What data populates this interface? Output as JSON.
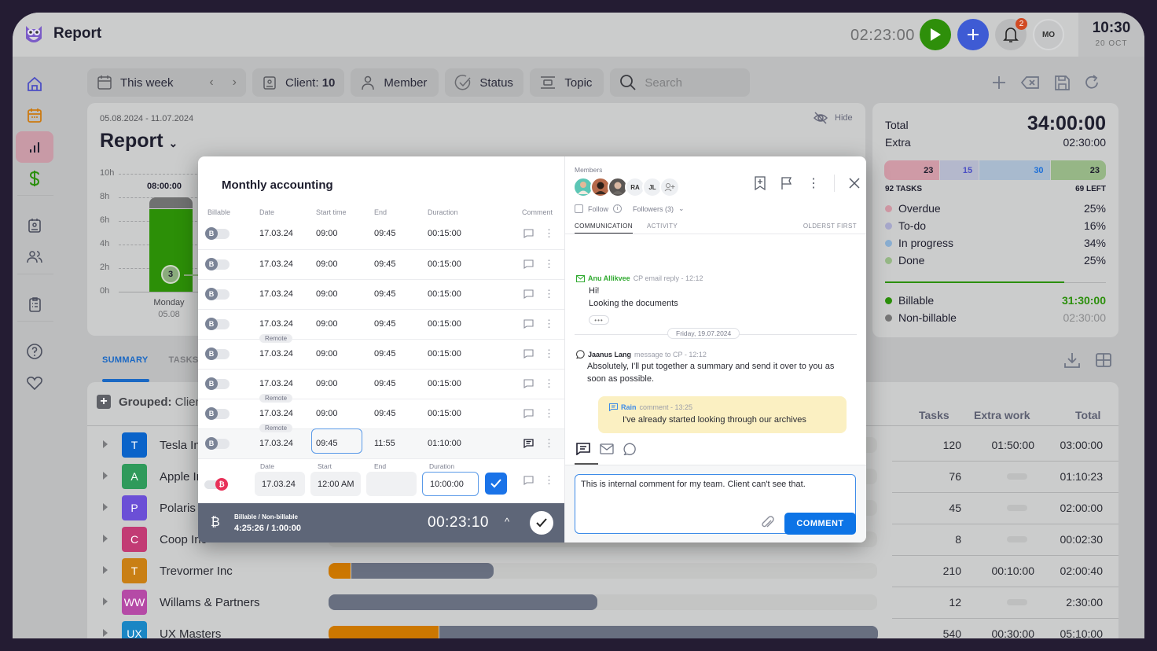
{
  "app": {
    "title": "Report"
  },
  "topbar": {
    "timer": "02:23:00",
    "notification_count": "2",
    "user_initials": "MO",
    "clock_time": "10:30",
    "clock_date": "20 OCT"
  },
  "sidebar": {
    "items": [
      {
        "name": "home",
        "icon": "home-icon"
      },
      {
        "name": "calendar",
        "icon": "calendar-icon"
      },
      {
        "name": "reports",
        "icon": "bar-chart-icon",
        "active": true
      },
      {
        "name": "billing",
        "icon": "dollar-icon"
      },
      {
        "name": "clients",
        "icon": "contact-card-icon"
      },
      {
        "name": "team",
        "icon": "users-icon"
      },
      {
        "name": "tasks",
        "icon": "clipboard-icon"
      },
      {
        "name": "help",
        "icon": "help-icon"
      },
      {
        "name": "favorites",
        "icon": "heart-icon"
      }
    ]
  },
  "filters": {
    "period": "This week",
    "client_label": "Client:",
    "client_count": "10",
    "member": "Member",
    "status": "Status",
    "topic": "Topic",
    "search_placeholder": "Search"
  },
  "report": {
    "date_range": "05.08.2024 - 11.07.2024",
    "title": "Report",
    "hide_label": "Hide"
  },
  "chart_data": {
    "type": "bar",
    "y_ticks": [
      "10h",
      "8h",
      "6h",
      "4h",
      "2h",
      "0h"
    ],
    "ylim": [
      0,
      10
    ],
    "categories": [
      {
        "day": "Monday",
        "date": "05.08"
      }
    ],
    "series": [
      {
        "name": "Billable",
        "values": [
          7
        ],
        "color": "#2c8f07"
      },
      {
        "name": "Non-billable",
        "values": [
          1
        ],
        "color": "#707171"
      }
    ],
    "total_labels": [
      "08:00:00"
    ],
    "bubble_label": "3"
  },
  "stats": {
    "total_label": "Total",
    "total_value": "34:00:00",
    "extra_label": "Extra",
    "extra_value": "02:30:00",
    "segments": [
      {
        "value": "23",
        "color": "#cf9aa6",
        "text": "#1e1e2e"
      },
      {
        "value": "15",
        "color": "#b4b8cc",
        "text": "#4b4fc4"
      },
      {
        "value": "30",
        "color": "#a8bace",
        "text": "#1e70d8"
      },
      {
        "value": "23",
        "color": "#96b686",
        "text": "#1e1e2e"
      }
    ],
    "tasks_count": "92 TASKS",
    "left_count": "69 LEFT",
    "legend": [
      {
        "label": "Overdue",
        "percent": "25%",
        "color": "#cf97a3"
      },
      {
        "label": "To-do",
        "percent": "16%",
        "color": "#a7a8cb"
      },
      {
        "label": "In progress",
        "percent": "34%",
        "color": "#8aaed1"
      },
      {
        "label": "Done",
        "percent": "25%",
        "color": "#96b886"
      }
    ],
    "billable_progress": 0.81,
    "billable_label": "Billable",
    "billable_value": "31:30:00",
    "nonbillable_label": "Non-billable",
    "nonbillable_value": "02:30:00"
  },
  "summary_tabs": [
    {
      "label": "SUMMARY",
      "active": true
    },
    {
      "label": "TASKS",
      "active": false
    }
  ],
  "table": {
    "grouped_label": "Grouped:",
    "grouped_value": "Client",
    "headers": {
      "tasks": "Tasks",
      "extra": "Extra work",
      "total": "Total"
    },
    "rows": [
      {
        "initial": "T",
        "name": "Tesla Inc",
        "color": "#0a63c9",
        "billable": 0,
        "nonbillable": 0,
        "tasks": "120",
        "extra": "01:50:00",
        "total": "03:00:00"
      },
      {
        "initial": "A",
        "name": "Apple Inc",
        "color": "#2f9a5b",
        "billable": 0,
        "nonbillable": 0,
        "tasks": "76",
        "extra": "",
        "total": "01:10:23"
      },
      {
        "initial": "P",
        "name": "Polaris Inc",
        "color": "#6b4fd6",
        "billable": 0,
        "nonbillable": 0,
        "tasks": "45",
        "extra": "",
        "total": "02:00:00"
      },
      {
        "initial": "C",
        "name": "Coop Inc",
        "color": "#c23b74",
        "billable": 0,
        "nonbillable": 0,
        "tasks": "8",
        "extra": "",
        "total": "00:02:30"
      },
      {
        "initial": "T",
        "name": "Trevormer Inc",
        "color": "#c97f14",
        "billable": 0.04,
        "nonbillable": 0.26,
        "tasks": "210",
        "extra": "00:10:00",
        "total": "02:00:40"
      },
      {
        "initial": "WW",
        "name": "Willams & Partners",
        "color": "#b54aa6",
        "billable": 0,
        "nonbillable": 0.49,
        "tasks": "12",
        "extra": "",
        "total": "2:30:00"
      },
      {
        "initial": "UX",
        "name": "UX Masters",
        "color": "#1a86c4",
        "billable": 0.2,
        "nonbillable": 0.8,
        "tasks": "540",
        "extra": "00:30:00",
        "total": "05:10:00"
      }
    ]
  },
  "modal": {
    "title": "Monthly accounting",
    "columns": [
      "Billable",
      "Date",
      "Start time",
      "End",
      "Duraction",
      "Comment"
    ],
    "entries": [
      {
        "date": "17.03.24",
        "start": "09:00",
        "end": "09:45",
        "duration": "00:15:00",
        "tag": ""
      },
      {
        "date": "17.03.24",
        "start": "09:00",
        "end": "09:45",
        "duration": "00:15:00",
        "tag": ""
      },
      {
        "date": "17.03.24",
        "start": "09:00",
        "end": "09:45",
        "duration": "00:15:00",
        "tag": ""
      },
      {
        "date": "17.03.24",
        "start": "09:00",
        "end": "09:45",
        "duration": "00:15:00",
        "tag": ""
      },
      {
        "date": "17.03.24",
        "start": "09:00",
        "end": "09:45",
        "duration": "00:15:00",
        "tag": "Remote"
      },
      {
        "date": "17.03.24",
        "start": "09:00",
        "end": "09:45",
        "duration": "00:15:00",
        "tag": ""
      },
      {
        "date": "17.03.24",
        "start": "09:00",
        "end": "09:45",
        "duration": "00:15:00",
        "tag": "Remote"
      },
      {
        "date": "17.03.24",
        "start": "09:45",
        "end": "11:55",
        "duration": "01:10:00",
        "tag": "Remote"
      }
    ],
    "edit": {
      "date_label": "Date",
      "start_label": "Start",
      "end_label": "End",
      "duration_label": "Duration",
      "date": "17.03.24",
      "start": "12:00 AM",
      "end": "",
      "duration": "10:00:00"
    },
    "footer": {
      "label": "Billable / Non-billable",
      "value": "4:25:26 / 1:00:00",
      "timer": "00:23:10"
    },
    "members_label": "Members",
    "member_initials": [
      "RA",
      "JL"
    ],
    "follow_label": "Follow",
    "followers_label": "Followers (3)",
    "tabs": [
      {
        "label": "COMMUNICATION",
        "active": true
      },
      {
        "label": "ACTIVITY",
        "active": false
      }
    ],
    "sort_label": "OLDERST FIRST",
    "messages": [
      {
        "author": "Anu Allikvee",
        "meta": "CP email reply - 12:12",
        "lines": [
          "Hi!",
          "Looking the documents"
        ]
      },
      {
        "author": "Jaanus Lang",
        "meta": "message to CP - 12:12",
        "lines": [
          "Absolutely, I'll put together a summary and send it over to you as soon as possible."
        ]
      },
      {
        "author": "Rain",
        "meta": "comment - 13:25",
        "lines": [
          "I've already started looking through our archives"
        ]
      }
    ],
    "day_separator": "Friday, 19.07.2024",
    "comment_text": "This is internal comment for my team. Client can't see that.",
    "comment_button": "COMMENT"
  }
}
